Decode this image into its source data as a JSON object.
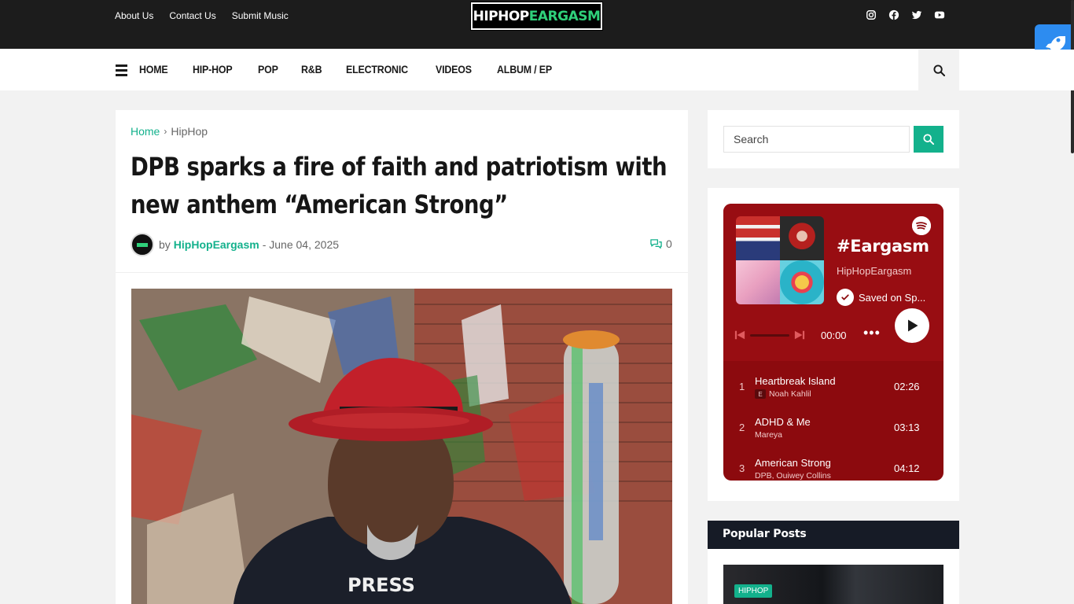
{
  "topbar": {
    "links": [
      "About Us",
      "Contact Us",
      "Submit Music"
    ],
    "logo_white": "HIPHOP",
    "logo_green": "EARGASM",
    "social_icons": [
      "instagram-icon",
      "facebook-icon",
      "twitter-icon",
      "youtube-icon"
    ]
  },
  "nav": {
    "items": [
      "HOME",
      "HIP-HOP",
      "POP",
      "R&B",
      "ELECTRONIC",
      "VIDEOS",
      "ALBUM / EP"
    ]
  },
  "breadcrumb": {
    "home": "Home",
    "current": "HipHop"
  },
  "article": {
    "title": "DPB sparks a fire of faith and patriotism with new anthem “American Strong”",
    "by": "by",
    "author": "HipHopEargasm",
    "date": "- June 04, 2025",
    "comments": "0"
  },
  "sidebar": {
    "search_placeholder": "Search",
    "spotify": {
      "playlist_name": "#Eargasm",
      "owner": "HipHopEargasm",
      "saved_text": "Saved on Sp...",
      "time": "00:00",
      "tracks": [
        {
          "num": "1",
          "name": "Heartbreak Island",
          "explicit": "E",
          "artist": "Noah Kahlil",
          "duration": "02:26"
        },
        {
          "num": "2",
          "name": "ADHD & Me",
          "explicit": "",
          "artist": "Mareya",
          "duration": "03:13"
        },
        {
          "num": "3",
          "name": "American Strong",
          "explicit": "",
          "artist": "DPB, Ouiwey Collins",
          "duration": "04:12"
        }
      ]
    },
    "popular_title": "Popular Posts",
    "popular_tag": "HIPHOP"
  },
  "colors": {
    "accent": "#13b18c",
    "topbar": "#1c1c1c",
    "spotify_bg": "#8c0a0e",
    "popular_header": "#161b26"
  }
}
